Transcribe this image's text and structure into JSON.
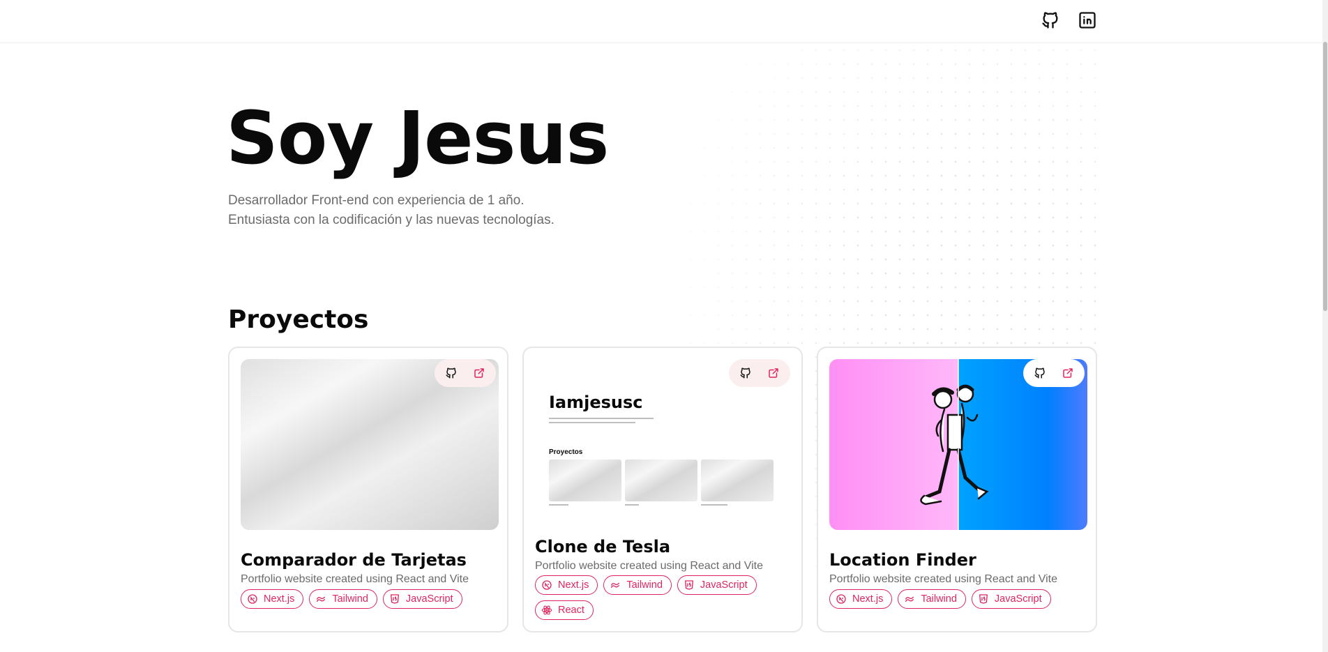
{
  "header": {
    "icons": [
      {
        "name": "github-icon"
      },
      {
        "name": "linkedin-icon"
      }
    ]
  },
  "hero": {
    "title": "Soy Jesus",
    "bio_line1": "Desarrollador Front-end con experiencia de 1 año.",
    "bio_line2": "Entusiasta con la codificación y las nuevas tecnologías."
  },
  "projects": {
    "heading": "Proyectos",
    "cards": [
      {
        "title": "Comparador de Tarjetas",
        "description": "Portfolio website created using React and Vite",
        "tags": [
          "Next.js",
          "Tailwind",
          "JavaScript"
        ]
      },
      {
        "title": "Clone de Tesla",
        "description": "Portfolio website created using React and Vite",
        "tags": [
          "Next.js",
          "Tailwind",
          "JavaScript",
          "React"
        ],
        "preview": {
          "title": "Iamjesusc",
          "section": "Proyectos"
        }
      },
      {
        "title": "Location Finder",
        "description": "Portfolio website created using React and Vite",
        "tags": [
          "Next.js",
          "Tailwind",
          "JavaScript"
        ]
      }
    ]
  },
  "colors": {
    "accent": "#e0245e",
    "muted_text": "#6b6b6b",
    "action_bg": "#fbeeee"
  }
}
